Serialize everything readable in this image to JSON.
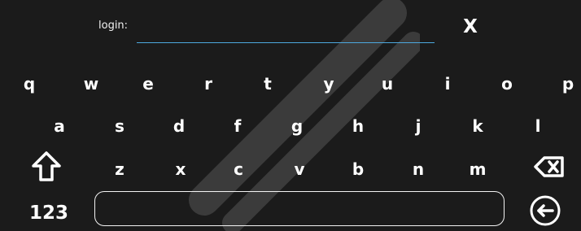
{
  "colors": {
    "background": "#1b1b1b",
    "text": "#ffffff",
    "input_underline": "#4da9df",
    "outline": "#f3f3f3"
  },
  "login": {
    "label": "login:",
    "value": ""
  },
  "close": {
    "label": "X"
  },
  "keyboard": {
    "row1": [
      "q",
      "w",
      "e",
      "r",
      "t",
      "y",
      "u",
      "i",
      "o",
      "p"
    ],
    "row2": [
      "a",
      "s",
      "d",
      "f",
      "g",
      "h",
      "j",
      "k",
      "l"
    ],
    "row3": [
      "z",
      "x",
      "c",
      "v",
      "b",
      "n",
      "m"
    ],
    "numeric_label": "123",
    "space_label": ""
  },
  "icons": {
    "shift": "shift-icon",
    "backspace": "backspace-icon",
    "enter": "enter-icon"
  }
}
